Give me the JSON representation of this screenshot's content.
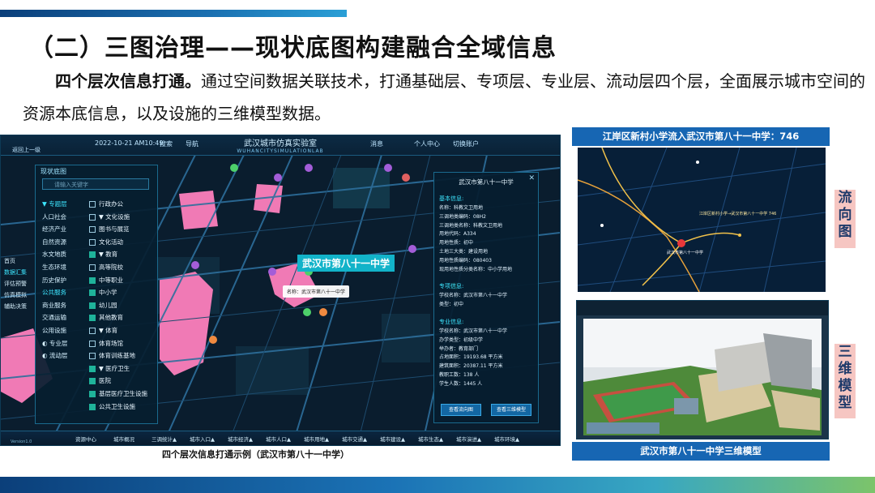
{
  "slide": {
    "title": "（二）三图治理——现状底图构建融合全域信息",
    "para_lead": "四个层次信息打通。",
    "para_body": "通过空间数据关联技术，打通基础层、专项层、专业层、流动层四个层，全面展示城市空间的资源本底信息，以及设施的三维模型数据。",
    "caption_left": "四个层次信息打通示例（武汉市第八十一中学）",
    "tag_top": "江岸区新村小学流入武汉市第八十一中学：746",
    "tag_bottom": "武汉市第八十一中学三维模型",
    "vtag_flow": [
      "流",
      "向",
      "图"
    ],
    "vtag_model": [
      "三",
      "维",
      "模",
      "型"
    ]
  },
  "app": {
    "header_left": "返回上一级",
    "date": "2022-10-21    AM10:49",
    "search": "搜索",
    "guide": "导航",
    "title": "武汉城市仿真实验室",
    "subtitle": "WUHANCITYSIMULATIONLAB",
    "hdr_right_1": "消息",
    "hdr_right_2": "个人中心",
    "hdr_right_3": "切换账户",
    "version": "Version1.0",
    "map_label": "武汉市第八十一中学",
    "bubble": "名称：武汉市第八十一中学",
    "sidenav": [
      "首页",
      "数据汇集",
      "评估预警",
      "仿真模拟",
      "辅助决策"
    ],
    "bottomnav": [
      "资源中心",
      "城市概况",
      "三调统计▲",
      "城市入口▲",
      "城市经济▲",
      "城市人口▲",
      "城市用地▲",
      "城市交通▲",
      "城市建设▲",
      "城市生态▲",
      "城市演进▲",
      "城市环境▲"
    ]
  },
  "left_panel": {
    "title": "现状底图",
    "search_placeholder": "请输入关键字",
    "cats": [
      {
        "label": "▼ 专题层",
        "sel": true
      },
      {
        "label": "人口社会"
      },
      {
        "label": "经济产业"
      },
      {
        "label": "自然资源"
      },
      {
        "label": "水文地质"
      },
      {
        "label": "生态环境"
      },
      {
        "label": "历史保护"
      },
      {
        "label": "公共服务",
        "sel": true
      },
      {
        "label": "商业服务"
      },
      {
        "label": "交通运输"
      },
      {
        "label": "公用设施"
      },
      {
        "label": "◐ 专业层"
      },
      {
        "label": "◐ 流动层"
      }
    ],
    "items": [
      {
        "label": "行政办公"
      },
      {
        "label": "▼ 文化设施"
      },
      {
        "label": "图书与展览"
      },
      {
        "label": "文化活动"
      },
      {
        "label": "▼ 教育",
        "chk": true
      },
      {
        "label": "高等院校"
      },
      {
        "label": "中等职业",
        "chk": true
      },
      {
        "label": "中小学",
        "chk": true
      },
      {
        "label": "幼儿园",
        "chk": true
      },
      {
        "label": "其他教育",
        "chk": true
      },
      {
        "label": "▼ 体育"
      },
      {
        "label": "体育场馆"
      },
      {
        "label": "体育训练基地"
      },
      {
        "label": "▼ 医疗卫生",
        "chk": true
      },
      {
        "label": "医院",
        "chk": true
      },
      {
        "label": "基层医疗卫生设施",
        "chk": true
      },
      {
        "label": "公共卫生设施",
        "chk": true
      }
    ]
  },
  "right_panel": {
    "title": "武汉市第八十一中学",
    "sec1": "基本信息:",
    "rows1": [
      "名称：科教文卫用地",
      "三调地类编码：08H2",
      "三调地类名称：科教文卫用地",
      "用地代码：A334",
      "用地性质：初中",
      "土地三大类：建设用地",
      "用地性质编码：080403",
      "现用地性质分类名称：中小学用地"
    ],
    "sec2": "专项信息:",
    "rows2": [
      "学校名称：武汉市第八十一中学",
      "类型：初中"
    ],
    "sec3": "专业信息:",
    "rows3": [
      "学校名称：武汉市第八十一中学",
      "办学类型：初级中学",
      "举办者：教育部门",
      "占地面积：19193.68 平方米",
      "建筑面积：20387.11 平方米",
      "教职工数：138 人",
      "学生人数：1445 人"
    ],
    "btn1": "查看流向图",
    "btn2": "查看三维模型"
  },
  "flow_map": {
    "label_main": "武汉市第八十一中学",
    "label_src": "江岸区新村小学→武汉市第八十一中学 746"
  }
}
